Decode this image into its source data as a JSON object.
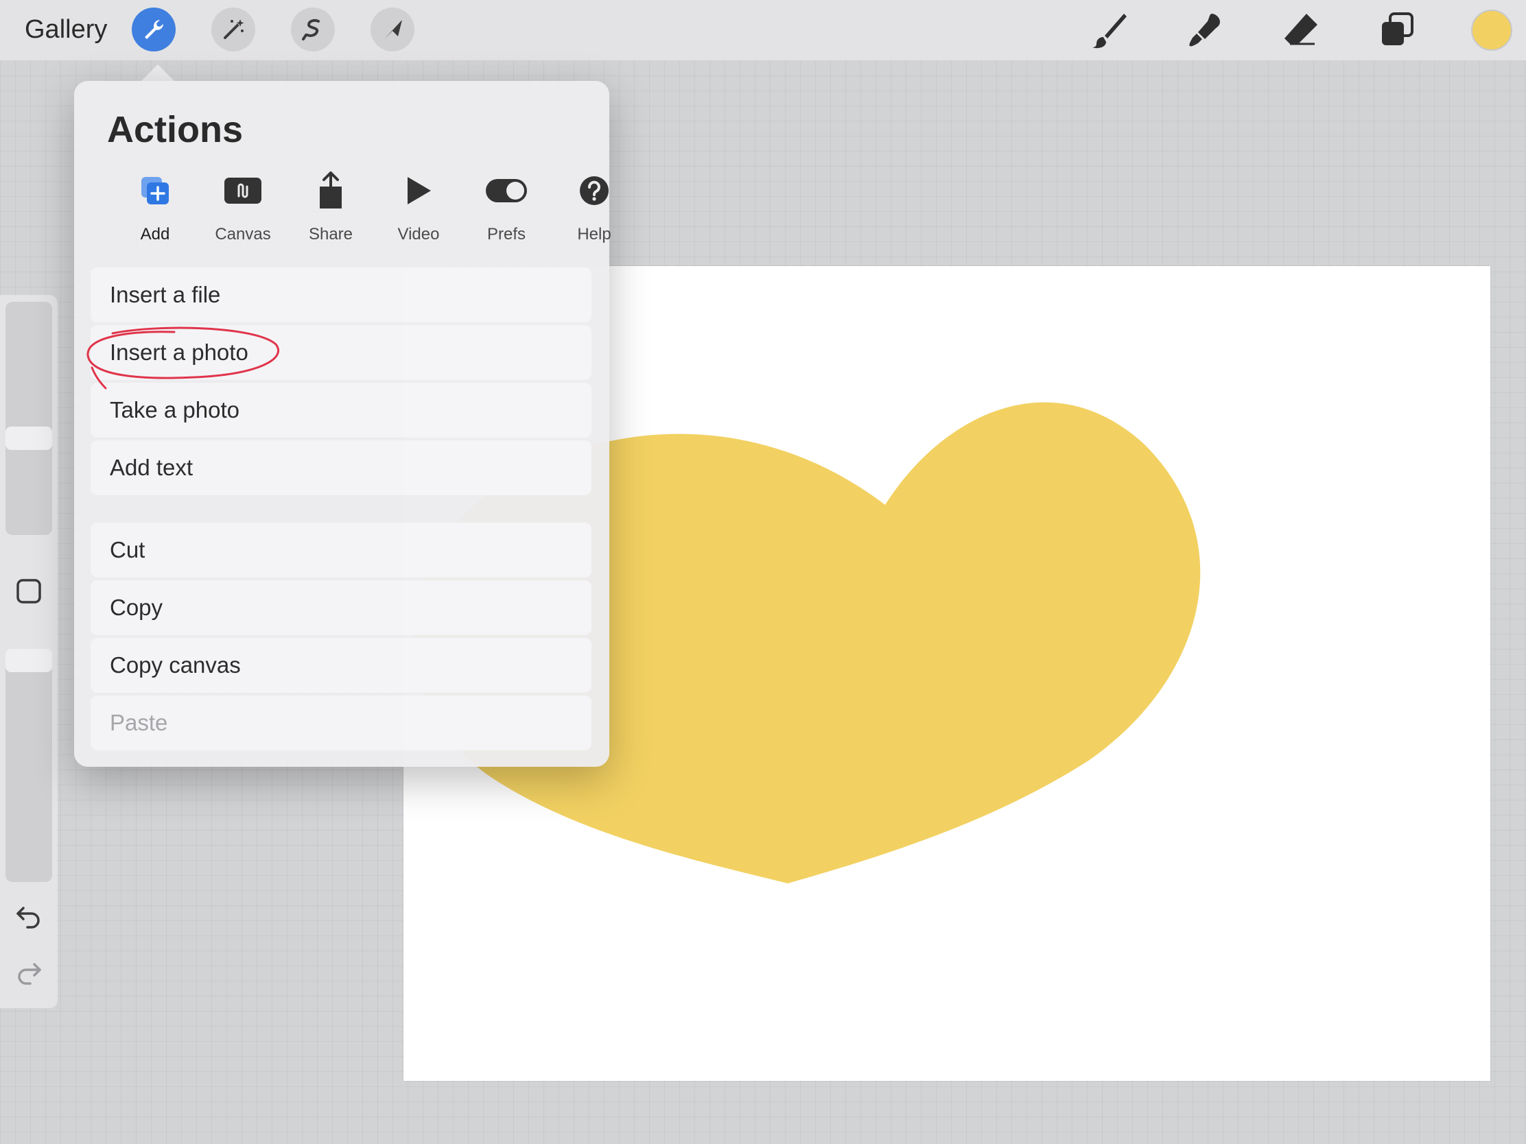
{
  "toolbar": {
    "gallery_label": "Gallery",
    "left_tools": [
      "wrench-actions",
      "magic-wand-adjustments",
      "selection",
      "transform-arrow"
    ],
    "right_tools": [
      "brush",
      "smudge",
      "eraser",
      "layers"
    ],
    "current_color": "#f2d162",
    "accent_color": "#3f7fe0"
  },
  "actions_panel": {
    "title": "Actions",
    "tabs": [
      {
        "label": "Add",
        "icon": "add-image-icon",
        "active": true
      },
      {
        "label": "Canvas",
        "icon": "canvas-icon"
      },
      {
        "label": "Share",
        "icon": "share-icon"
      },
      {
        "label": "Video",
        "icon": "play-icon"
      },
      {
        "label": "Prefs",
        "icon": "toggle-icon"
      },
      {
        "label": "Help",
        "icon": "help-icon"
      }
    ],
    "menu_group_1": [
      {
        "label": "Insert a file"
      },
      {
        "label": "Insert a photo",
        "highlighted": true
      },
      {
        "label": "Take a photo"
      },
      {
        "label": "Add text"
      }
    ],
    "menu_group_2": [
      {
        "label": "Cut"
      },
      {
        "label": "Copy"
      },
      {
        "label": "Copy canvas"
      },
      {
        "label": "Paste",
        "disabled": true
      }
    ]
  },
  "canvas": {
    "shape": "heart",
    "fill_color": "#f2d162"
  }
}
